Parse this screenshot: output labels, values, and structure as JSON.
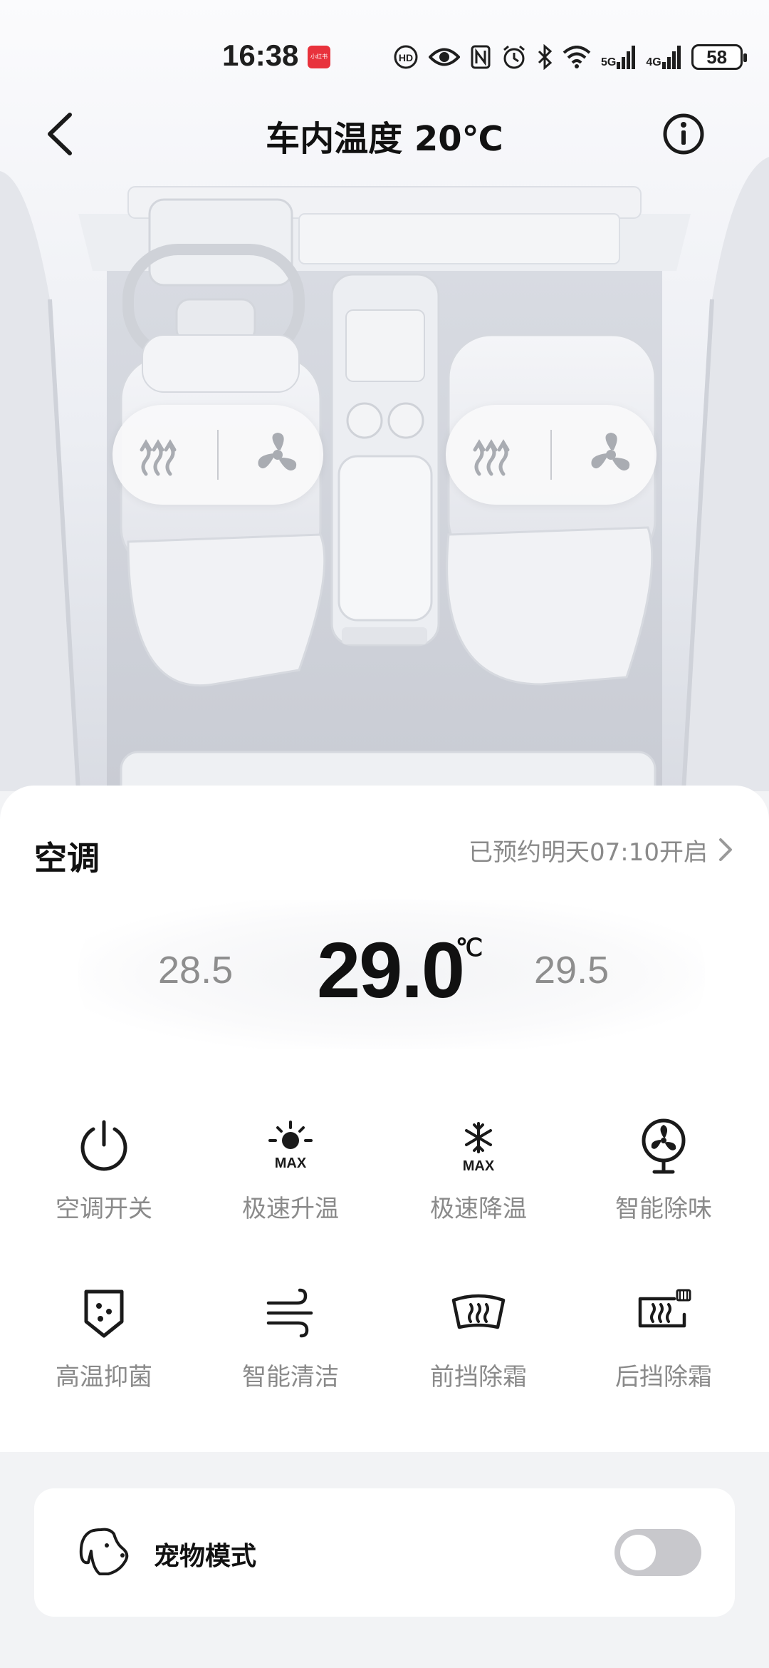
{
  "status_bar": {
    "time": "16:38",
    "badge": "小红书",
    "network_5g": "5G",
    "network_4g": "4G",
    "battery": "58",
    "icons": [
      "hd-icon",
      "eye-icon",
      "nfc-icon",
      "alarm-icon",
      "bluetooth-icon",
      "wifi-icon",
      "signal-5g-icon",
      "signal-4g-icon",
      "battery-icon"
    ]
  },
  "header": {
    "title": "车内温度 20℃",
    "back_icon": "chevron-left-icon",
    "info_icon": "info-icon"
  },
  "seats": {
    "driver": {
      "heat_icon": "seat-heat-icon",
      "vent_icon": "seat-fan-icon"
    },
    "passenger": {
      "heat_icon": "seat-heat-icon",
      "vent_icon": "seat-fan-icon"
    }
  },
  "ac": {
    "title": "空调",
    "schedule": "已预约明天07:10开启",
    "temp_lower": "28.5",
    "temp_current": "29.0",
    "temp_unit": "℃",
    "temp_higher": "29.5"
  },
  "functions": [
    {
      "label": "空调开关",
      "icon": "power-icon"
    },
    {
      "label": "极速升温",
      "icon": "sun-max-icon"
    },
    {
      "label": "极速降温",
      "icon": "snowflake-max-icon"
    },
    {
      "label": "智能除味",
      "icon": "fan-icon"
    },
    {
      "label": "高温抑菌",
      "icon": "shield-dots-icon"
    },
    {
      "label": "智能清洁",
      "icon": "wind-icon"
    },
    {
      "label": "前挡除霜",
      "icon": "front-defrost-icon"
    },
    {
      "label": "后挡除霜",
      "icon": "rear-defrost-icon"
    }
  ],
  "max_label": "MAX",
  "pet_mode": {
    "label": "宠物模式",
    "icon": "dog-icon",
    "enabled": false
  },
  "colors": {
    "background": "#f2f3f5",
    "card": "#ffffff",
    "text_primary": "#111111",
    "text_secondary": "#8a8a8a",
    "toggle_off": "#c8c8cc",
    "badge_red": "#e8323c"
  }
}
